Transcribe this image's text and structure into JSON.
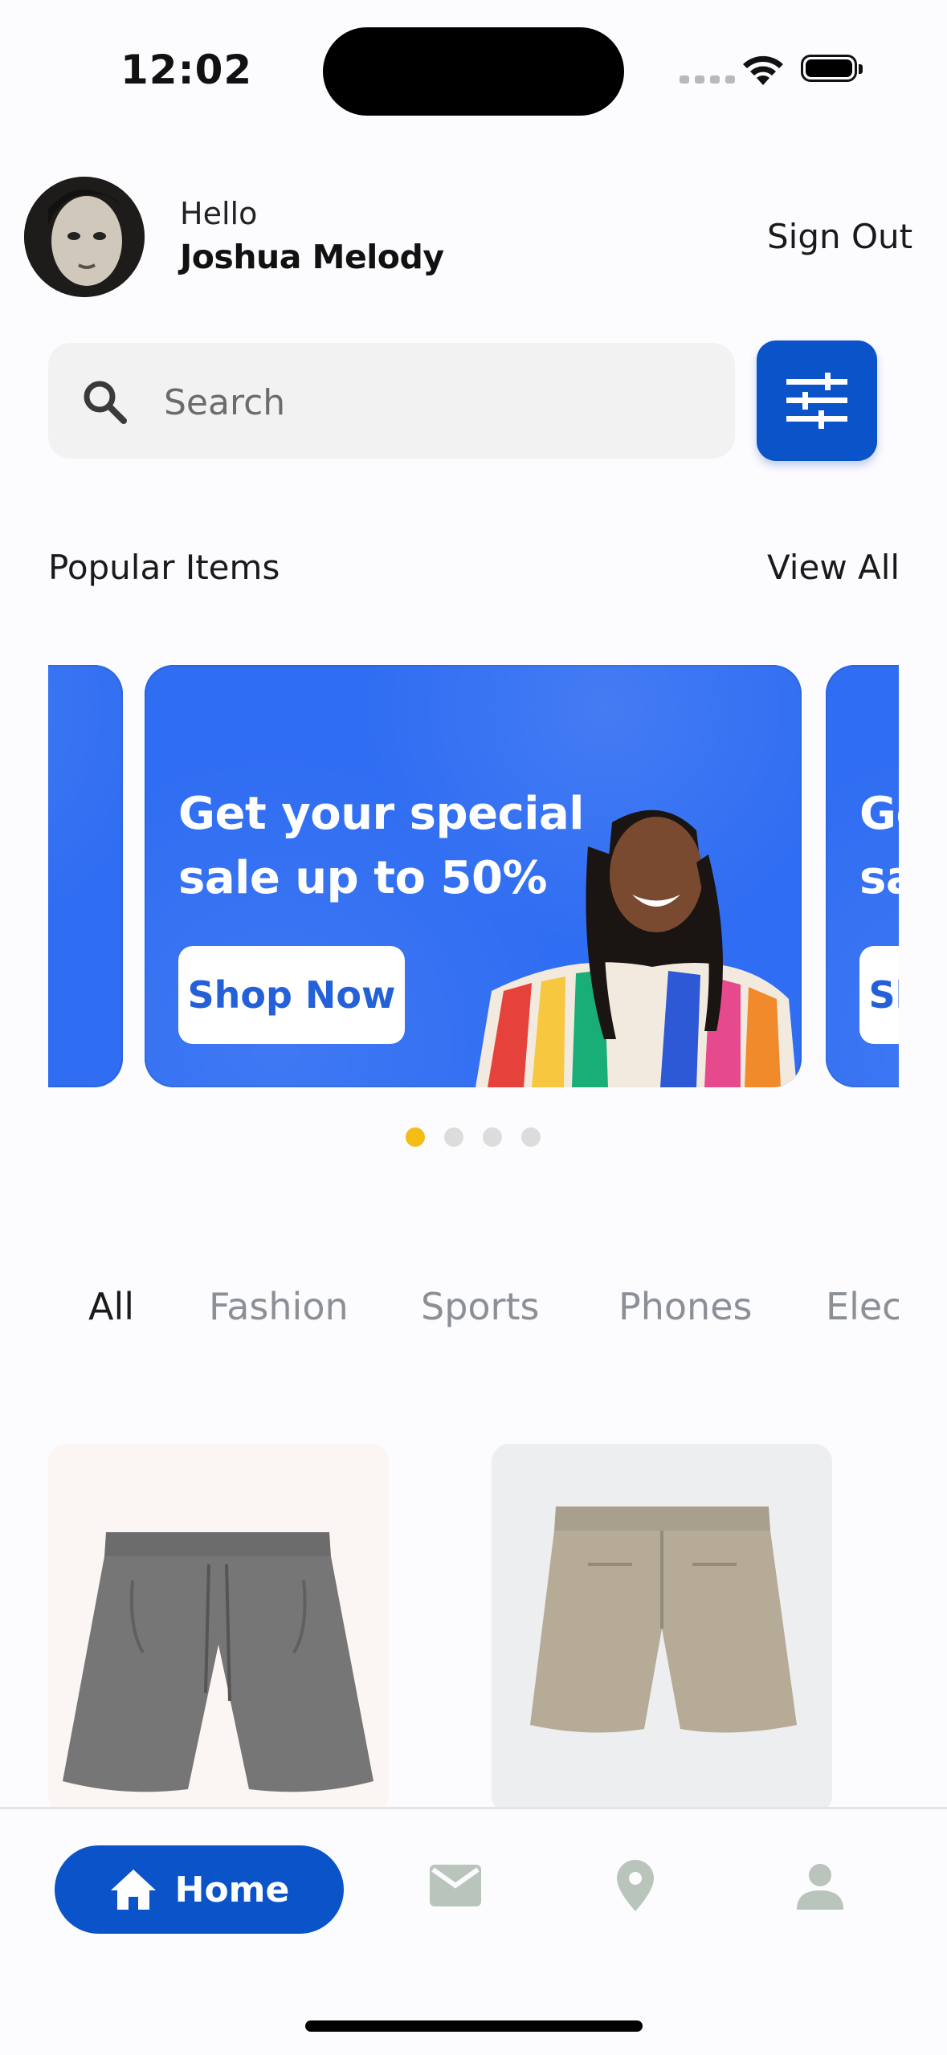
{
  "status_bar": {
    "time": "12:02"
  },
  "header": {
    "greeting": "Hello",
    "user_name": "Joshua Melody",
    "sign_out_label": "Sign Out"
  },
  "search": {
    "placeholder": "Search",
    "value": ""
  },
  "popular": {
    "title": "Popular Items",
    "view_all_label": "View All",
    "banners": [
      {
        "headline": "Get your special sale up to 50%",
        "button_label": "Shop Now"
      }
    ],
    "dots_count": 4,
    "active_dot": 1
  },
  "categories": [
    "All",
    "Fashion",
    "Sports",
    "Phones",
    "Elec"
  ],
  "selected_category": "All",
  "nav": {
    "home_label": "Home"
  },
  "colors": {
    "primary": "#0a53c9",
    "banner": "#2f6df2",
    "dot_active": "#f4bd16",
    "icon_inactive": "#b9c4bb"
  }
}
